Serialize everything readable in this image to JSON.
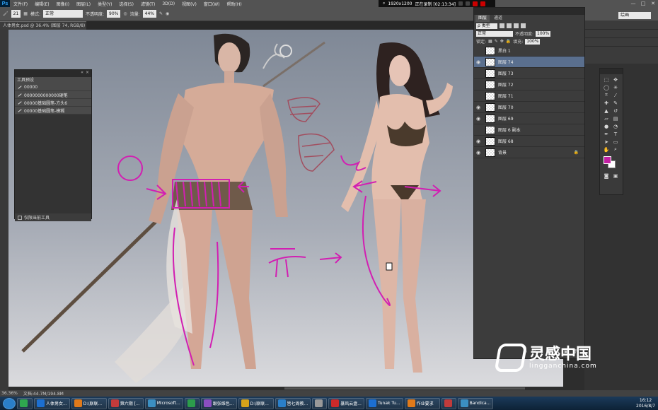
{
  "app": {
    "logo": "Ps",
    "tool_icon": "brush-icon"
  },
  "menus": [
    "文件(F)",
    "编辑(E)",
    "图像(I)",
    "图层(L)",
    "类型(Y)",
    "选择(S)",
    "滤镜(T)",
    "3D(D)",
    "视图(V)",
    "窗口(W)",
    "帮助(H)"
  ],
  "recorder": {
    "resolution": "1920x1200",
    "status": "正在录制 [02:13:34]"
  },
  "window_controls": [
    "—",
    "□",
    "✕"
  ],
  "options": {
    "brush_size": "21",
    "mode_label": "模式:",
    "mode_value": "正常",
    "opacity_label": "不透明度:",
    "opacity_value": "90%",
    "flow_label": "流量:",
    "flow_value": "44%",
    "workspace_value": "绘画"
  },
  "document": {
    "tab_title": "人体男女.psd @ 36.4% (图层 74, RGB/8) *"
  },
  "tool_presets": {
    "tab_label": "工具预设",
    "items": [
      "00000",
      "0000000000000硬笔",
      "00000基础圆笔-方头6",
      "00000基础圆笔-模糊"
    ],
    "current_tool_only": "仅限当前工具"
  },
  "layers_panel": {
    "tabs": [
      "图层",
      "通道"
    ],
    "filter_label": "ρ 类型",
    "blend_mode": "正常",
    "opacity_label": "不透明度:",
    "opacity_value": "100%",
    "lock_label": "锁定:",
    "fill_label": "填充:",
    "fill_value": "100%",
    "layers": [
      {
        "name": "黑白 1",
        "visible": false
      },
      {
        "name": "图层 74",
        "visible": true,
        "selected": true
      },
      {
        "name": "图层 73",
        "visible": false
      },
      {
        "name": "图层 72",
        "visible": false
      },
      {
        "name": "图层 71",
        "visible": false
      },
      {
        "name": "图层 70",
        "visible": true
      },
      {
        "name": "图层 69",
        "visible": true
      },
      {
        "name": "图层 6 副本",
        "visible": false
      },
      {
        "name": "图层 68",
        "visible": true
      },
      {
        "name": "背景",
        "visible": true,
        "locked": true
      }
    ]
  },
  "colors": {
    "foreground": "#c21fa2",
    "background": "#ffffff"
  },
  "status": {
    "zoom": "36.36%",
    "doc_size": "文档:44.7M/194.8M"
  },
  "taskbar": {
    "items": [
      "人体男女...",
      "D:\\联联...",
      "第六期 [...",
      "Microsoft...",
      "",
      "跟张维色...",
      "D:\\联联...",
      "皆七周教...",
      "",
      "暴风云盘...",
      "Tunak Tu...",
      "作业要求",
      "",
      "Bandica..."
    ],
    "time": "16:12",
    "date": "2016/8/7"
  },
  "watermark": {
    "name": "灵感中国",
    "url": "lingganchina.com"
  }
}
